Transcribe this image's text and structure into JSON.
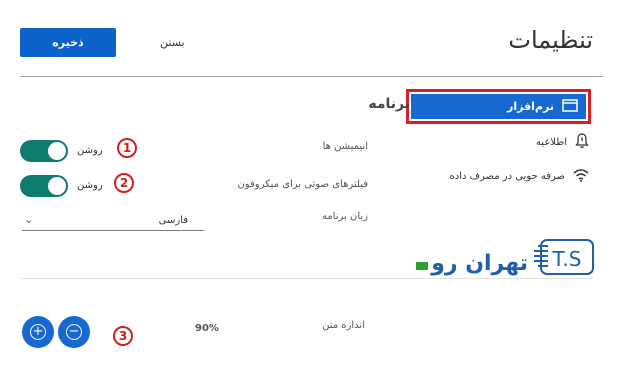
{
  "header": {
    "title": "تنظیمات",
    "save_label": "ذخیره",
    "close_label": "بستن"
  },
  "sidebar": {
    "items": [
      {
        "label": "نرم‌افزار",
        "icon": "window-icon",
        "selected": true
      },
      {
        "label": "اطلاعیه",
        "icon": "bell-icon"
      },
      {
        "label": "صرفه جویی در مصرف داده",
        "icon": "wifi-icon"
      }
    ]
  },
  "section": {
    "title": "برنامه",
    "animations": {
      "label": "انیمیشن ها",
      "state": "روشن",
      "on": true,
      "marker": "1"
    },
    "mic_filters": {
      "label": "فیلترهای صوتی برای میکروفون",
      "state": "روشن",
      "on": true,
      "marker": "2"
    },
    "language": {
      "label": "زبان برنامه",
      "value": "فارسی"
    },
    "text_size": {
      "label": "اندازه متن",
      "value": "90%",
      "marker": "3"
    }
  },
  "watermark": {
    "logo": "T.S",
    "text": "تهران رو"
  },
  "colors": {
    "primary": "#1769d1",
    "toggle": "#0f7a6e",
    "marker": "#d01f1f",
    "highlight_border": "#d9202a"
  }
}
